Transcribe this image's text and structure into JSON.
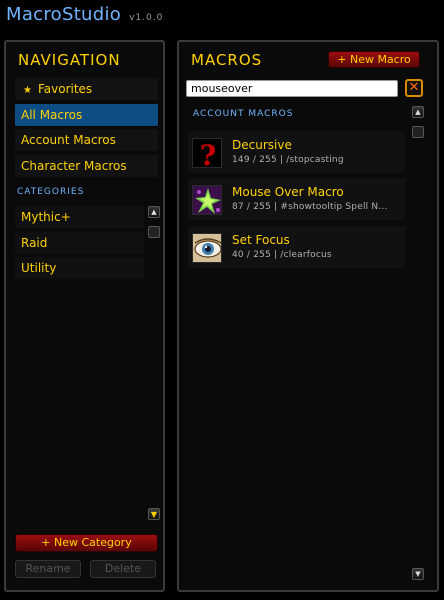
{
  "app": {
    "title": "MacroStudio",
    "version": "v1.0.0"
  },
  "navigation": {
    "title": "NAVIGATION",
    "items": [
      {
        "label": "Favorites",
        "icon": "star-icon"
      },
      {
        "label": "All Macros"
      },
      {
        "label": "Account Macros"
      },
      {
        "label": "Character Macros"
      }
    ],
    "selected": "All Macros",
    "categories_label": "CATEGORIES",
    "categories": [
      "Mythic+",
      "Raid",
      "Utility"
    ],
    "new_category_label": "+ New Category",
    "rename_label": "Rename",
    "delete_label": "Delete"
  },
  "macros": {
    "title": "MACROS",
    "new_macro_label": "+ New Macro",
    "search_value": "mouseover",
    "section_label": "ACCOUNT MACROS",
    "list": [
      {
        "name": "Decursive",
        "meta": "149 / 255  |  /stopcasting",
        "icon": "question-mark-icon"
      },
      {
        "name": "Mouse Over Macro",
        "meta": "87 / 255  |  #showtooltip Spell N...",
        "icon": "nature-spell-icon"
      },
      {
        "name": "Set Focus",
        "meta": "40 / 255  |  /clearfocus",
        "icon": "eye-icon"
      }
    ]
  },
  "colors": {
    "accent_gold": "#ffd100",
    "accent_blue": "#6fb4ff",
    "selected_bg": "#0e4d84",
    "button_red": "#9b0f0f"
  }
}
